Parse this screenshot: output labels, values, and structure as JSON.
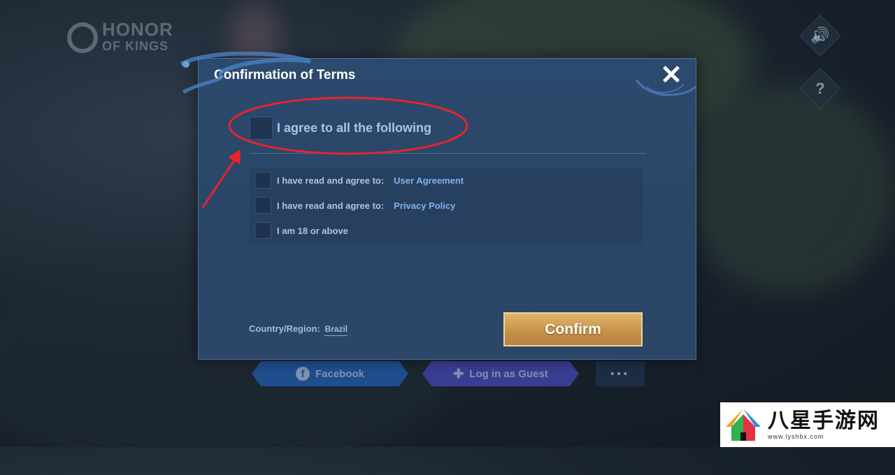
{
  "background": {
    "logo_text_line1": "HONOR",
    "logo_text_line2": "OF KINGS",
    "sound_icon": "speaker-icon",
    "help_icon": "question-icon"
  },
  "login_buttons": {
    "facebook": "Facebook",
    "guest": "Log in as Guest",
    "more": "•••"
  },
  "dialog": {
    "title": "Confirmation of Terms",
    "close_icon": "close-icon",
    "agree_all": "I agree to all the following",
    "items": [
      {
        "text": "I have read and agree to:",
        "link": "User Agreement"
      },
      {
        "text": "I have read and agree to:",
        "link": "Privacy Policy"
      },
      {
        "text": "I am 18 or above",
        "link": ""
      }
    ],
    "country_label": "Country/Region:",
    "country_value": "Brazil",
    "confirm": "Confirm"
  },
  "watermark": {
    "title": "八星手游网",
    "url": "www.lyshbx.com"
  },
  "colors": {
    "dialog_bg": "#2b4667",
    "confirm_gold": "#c7934a",
    "link_blue": "#7fb3ee",
    "annotation_red": "#e8242b"
  }
}
